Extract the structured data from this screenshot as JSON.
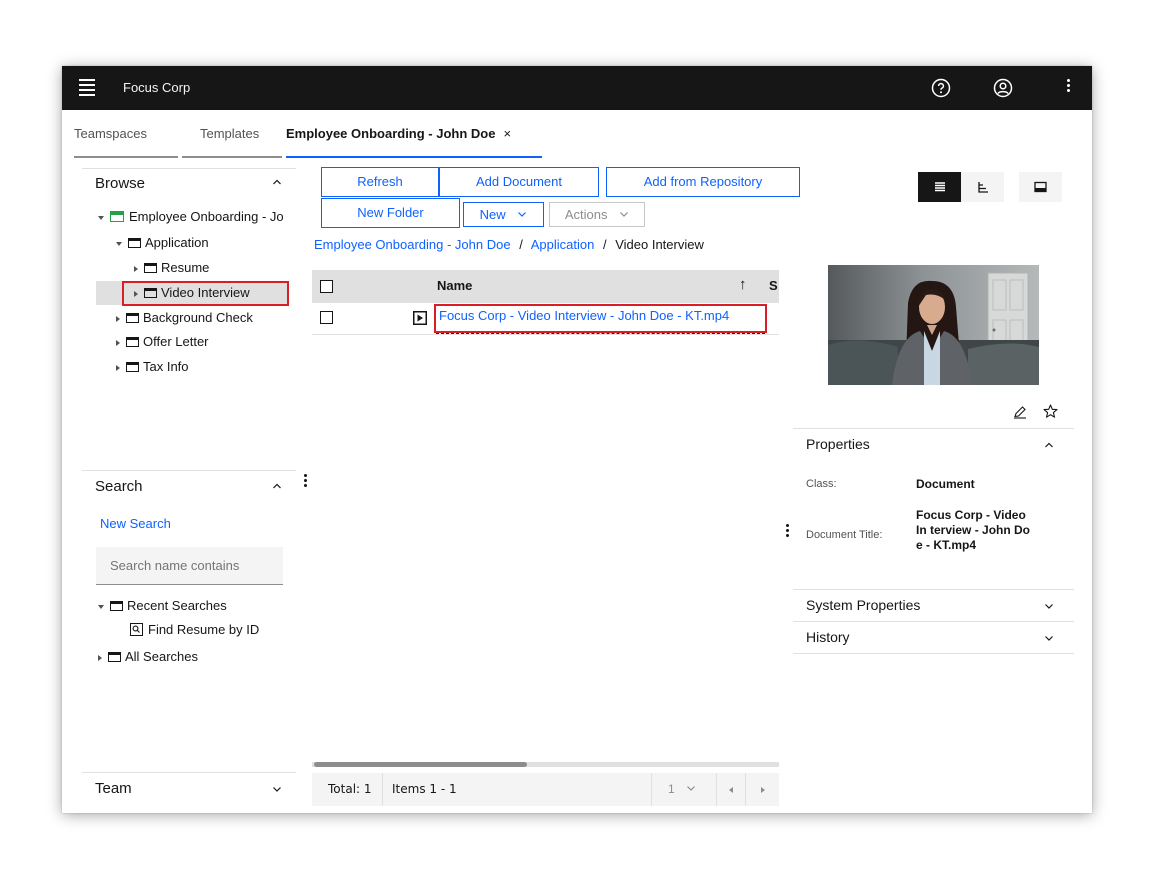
{
  "header": {
    "brand": "Focus Corp"
  },
  "tabs": [
    {
      "label": "Teamspaces"
    },
    {
      "label": "Templates"
    },
    {
      "label": "Employee Onboarding - John Doe",
      "close": "×"
    }
  ],
  "browse": {
    "title": "Browse",
    "root": "Employee Onboarding - Jo",
    "items": [
      {
        "label": "Application"
      },
      {
        "label": "Resume"
      },
      {
        "label": "Video Interview"
      },
      {
        "label": "Background Check"
      },
      {
        "label": "Offer Letter"
      },
      {
        "label": "Tax Info"
      }
    ]
  },
  "search": {
    "title": "Search",
    "new_search": "New Search",
    "placeholder": "Search name contains",
    "recent": "Recent Searches",
    "saved": "Find Resume by ID",
    "all": "All Searches"
  },
  "team": {
    "title": "Team"
  },
  "toolbar": {
    "refresh": "Refresh",
    "add_document": "Add Document",
    "add_from_repo": "Add from Repository",
    "new_folder": "New Folder",
    "new": "New",
    "actions": "Actions"
  },
  "breadcrumb": {
    "items": [
      "Employee Onboarding - John Doe",
      "Application",
      "Video Interview"
    ],
    "separator": "/"
  },
  "grid": {
    "col_name": "Name",
    "sort_indicator": "↑",
    "col_next": "S",
    "rows": [
      {
        "name": "Focus Corp - Video Interview - John Doe - KT.mp4"
      }
    ]
  },
  "footer": {
    "total": "Total: 1",
    "items": "Items 1 - 1",
    "page": "1"
  },
  "properties": {
    "title": "Properties",
    "class_label": "Class:",
    "class_value": "Document",
    "doc_title_label": "Document Title:",
    "doc_title_value": "Focus Corp - Video In terview - John Do e - KT.mp4",
    "system_properties": "System Properties",
    "history": "History"
  },
  "colors": {
    "accent": "#0f62fe",
    "highlight": "#da1e28",
    "header_bg": "#161616",
    "video_icon": "#24a148"
  }
}
